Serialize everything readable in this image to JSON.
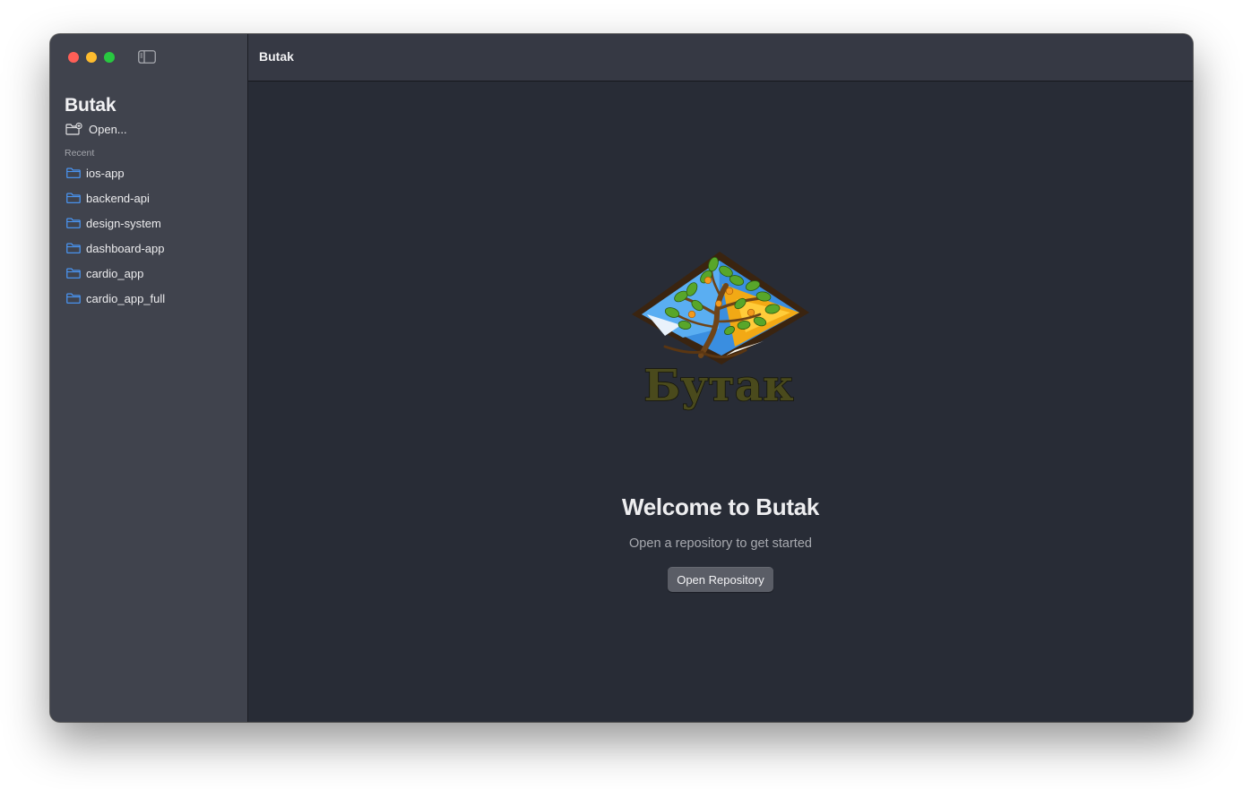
{
  "window": {
    "traffic_lights": {
      "close": "#ff5f57",
      "minimize": "#febc2e",
      "zoom": "#28c840"
    }
  },
  "sidebar": {
    "toggle_icon": "sidebar-left-icon",
    "app_title": "Butak",
    "open_label": "Open...",
    "open_icon": "folder-badge-plus-icon",
    "recent_label": "Recent",
    "folder_icon": "folder-icon",
    "folder_icon_color": "#4a9bff",
    "recent": [
      {
        "label": "ios-app"
      },
      {
        "label": "backend-api"
      },
      {
        "label": "design-system"
      },
      {
        "label": "dashboard-app"
      },
      {
        "label": "cardio_app"
      },
      {
        "label": "cardio_app_full"
      }
    ]
  },
  "toolbar": {
    "title": "Butak"
  },
  "main": {
    "logo_text": "Бутак",
    "welcome_title": "Welcome to Butak",
    "welcome_subtitle": "Open a repository to get started",
    "open_repository_label": "Open Repository"
  }
}
